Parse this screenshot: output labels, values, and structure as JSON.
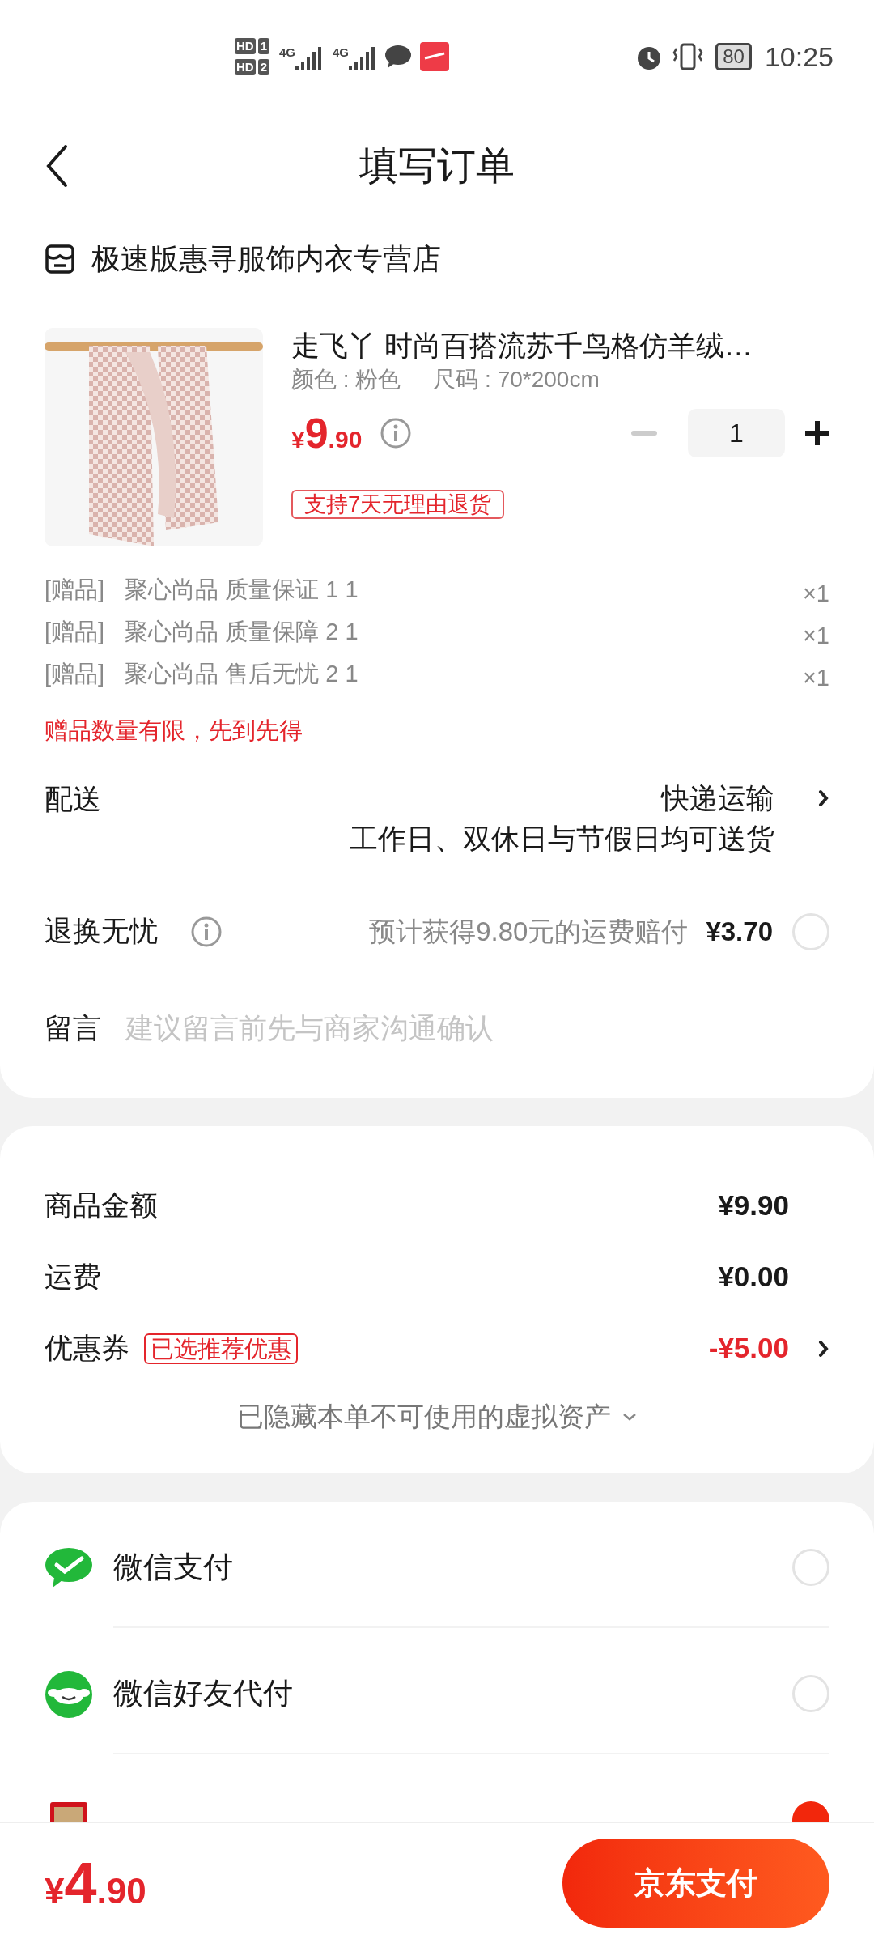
{
  "status_bar": {
    "sims": [
      {
        "label": "HD",
        "slot": "1"
      },
      {
        "label": "HD",
        "slot": "2"
      }
    ],
    "networks": [
      "4G",
      "4G"
    ],
    "battery": "80",
    "time": "10:25"
  },
  "header": {
    "title": "填写订单"
  },
  "store": {
    "name": "极速版惠寻服饰内衣专营店"
  },
  "product": {
    "title": "走飞丫 时尚百搭流苏千鸟格仿羊绒…",
    "spec_color": "颜色 : 粉色",
    "spec_size": "尺码 : 70*200cm",
    "price": {
      "symbol": "¥",
      "integer": "9",
      "decimal": ".90"
    },
    "quantity": "1",
    "minus_disabled": true,
    "tag": "支持7天无理由退货"
  },
  "gifts": [
    {
      "tag": "[赠品]",
      "name": "聚心尚品 质量保证 1 1",
      "count": "×1"
    },
    {
      "tag": "[赠品]",
      "name": "聚心尚品 质量保障 2 1",
      "count": "×1"
    },
    {
      "tag": "[赠品]",
      "name": "聚心尚品 售后无忧 2 1",
      "count": "×1"
    }
  ],
  "gift_note": "赠品数量有限，先到先得",
  "delivery": {
    "label": "配送",
    "method": "快递运输",
    "detail": "工作日、双休日与节假日均可送货"
  },
  "return_service": {
    "label": "退换无忧",
    "description": "预计获得9.80元的运费赔付",
    "price": "¥3.70",
    "selected": false
  },
  "message": {
    "label": "留言",
    "placeholder": "建议留言前先与商家沟通确认"
  },
  "summary": {
    "rows": [
      {
        "label": "商品金额",
        "value": "¥9.90",
        "kind": "plain"
      },
      {
        "label": "运费",
        "value": "¥0.00",
        "kind": "plain"
      },
      {
        "label": "优惠券",
        "badge": "已选推荐优惠",
        "value": "-¥5.00",
        "kind": "coupon"
      }
    ],
    "hidden_note": "已隐藏本单不可使用的虚拟资产"
  },
  "payment_methods": [
    {
      "kind": "wechat",
      "label": "微信支付",
      "selected": false
    },
    {
      "kind": "friend",
      "label": "微信好友代付",
      "selected": false
    },
    {
      "kind": "card",
      "selected": true
    }
  ],
  "bottom_bar": {
    "total": {
      "symbol": "¥",
      "integer": "4",
      "decimal": ".90"
    },
    "pay_button": "京东支付"
  }
}
